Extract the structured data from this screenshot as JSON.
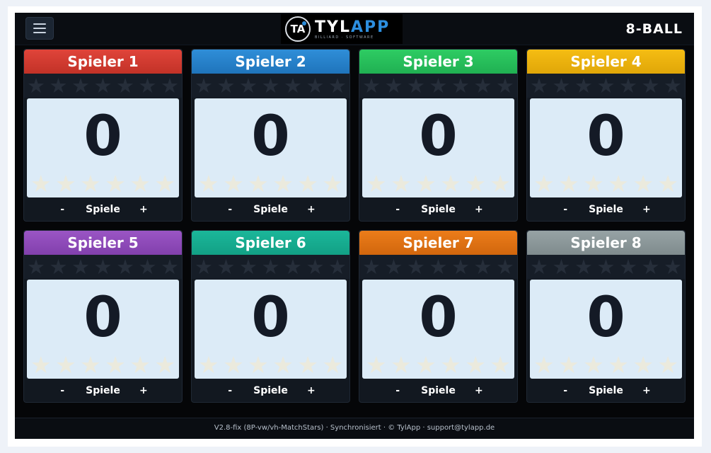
{
  "header": {
    "menu_icon": "hamburger-icon",
    "logo_prefix": "TYL",
    "logo_suffix": "APP",
    "logo_sub": "BILLIARD · SOFTWARE",
    "logo_mark": "TA",
    "game_title": "8-BALL"
  },
  "players": [
    {
      "name": "Spieler 1",
      "score": "0",
      "color": "#e0443a",
      "color2": "#c23227",
      "minus": "-",
      "games_label": "Spiele",
      "plus": "+"
    },
    {
      "name": "Spieler 2",
      "score": "0",
      "color": "#2f8ed8",
      "color2": "#1f74bb",
      "minus": "-",
      "games_label": "Spiele",
      "plus": "+"
    },
    {
      "name": "Spieler 3",
      "score": "0",
      "color": "#2ecc63",
      "color2": "#20b052",
      "minus": "-",
      "games_label": "Spiele",
      "plus": "+"
    },
    {
      "name": "Spieler 4",
      "score": "0",
      "color": "#f5bd13",
      "color2": "#e0a608",
      "minus": "-",
      "games_label": "Spiele",
      "plus": "+"
    },
    {
      "name": "Spieler 5",
      "score": "0",
      "color": "#9a55c4",
      "color2": "#8240ad",
      "minus": "-",
      "games_label": "Spiele",
      "plus": "+"
    },
    {
      "name": "Spieler 6",
      "score": "0",
      "color": "#1bb79a",
      "color2": "#12a085",
      "minus": "-",
      "games_label": "Spiele",
      "plus": "+"
    },
    {
      "name": "Spieler 7",
      "score": "0",
      "color": "#ec7d1a",
      "color2": "#d1660d",
      "minus": "-",
      "games_label": "Spiele",
      "plus": "+"
    },
    {
      "name": "Spieler 8",
      "score": "0",
      "color": "#97a3a5",
      "color2": "#7f8b8d",
      "minus": "-",
      "games_label": "Spiele",
      "plus": "+"
    }
  ],
  "match_stars": 7,
  "rack_stars": 6,
  "footer": {
    "text": "V2.8-fix (8P-vw/vh-MatchStars) · Synchronisiert · © TylApp · support@tylapp.de"
  }
}
